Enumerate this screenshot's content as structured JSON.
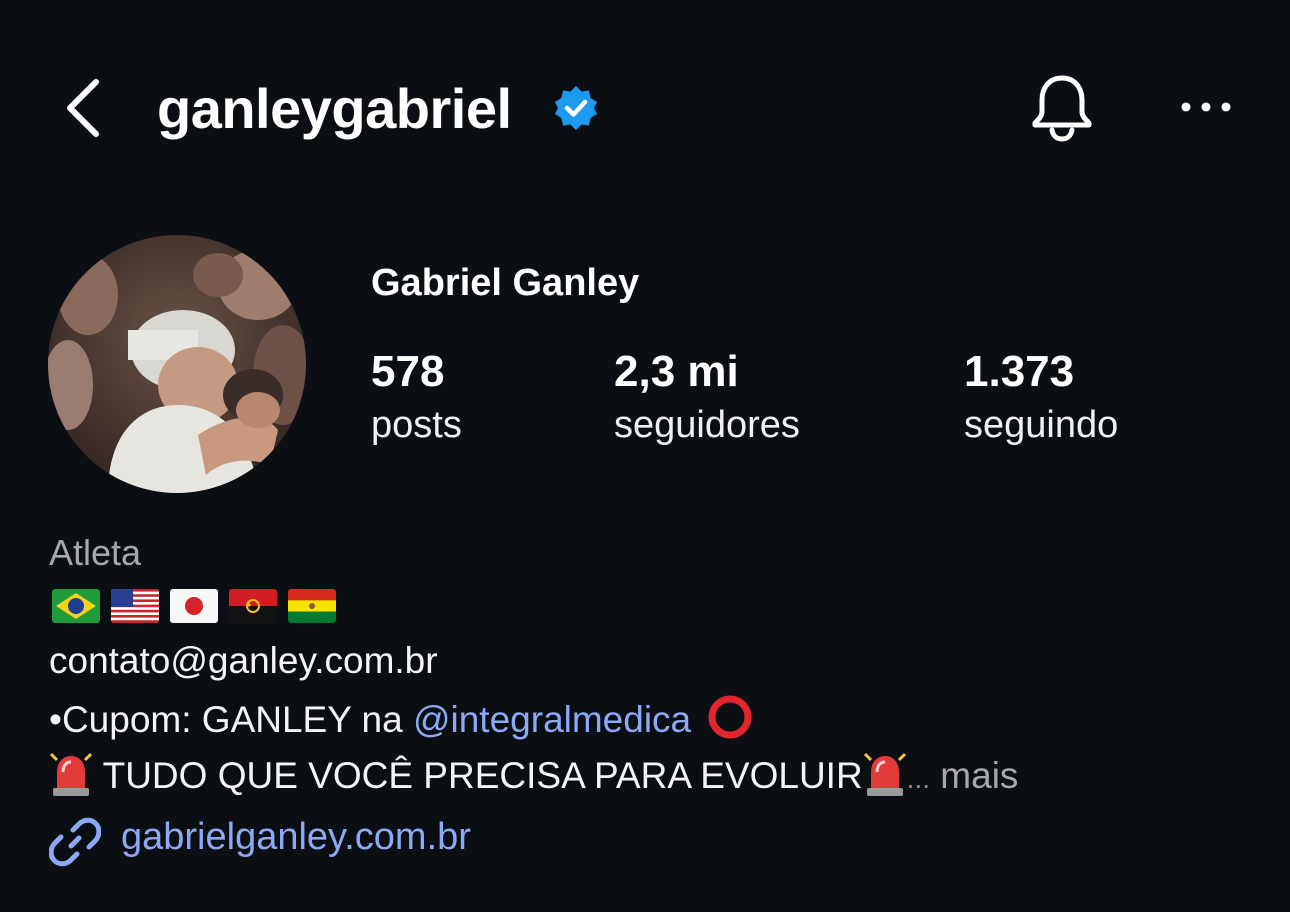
{
  "header": {
    "username": "ganleygabriel",
    "back_icon": "chevron-left-icon",
    "verified_icon": "verified-badge-icon",
    "bell_icon": "bell-icon",
    "more_icon": "more-horizontal-icon"
  },
  "profile": {
    "full_name": "Gabriel Ganley",
    "stats": [
      {
        "value": "578",
        "label": "posts"
      },
      {
        "value": "2,3 mi",
        "label": "seguidores"
      },
      {
        "value": "1.373",
        "label": "seguindo"
      }
    ]
  },
  "bio": {
    "category": "Atleta",
    "flags": [
      "brazil-flag-icon",
      "usa-flag-icon",
      "japan-flag-icon",
      "angola-flag-icon",
      "bolivia-flag-icon"
    ],
    "email": "contato@ganley.com.br",
    "coupon_prefix": "•Cupom: GANLEY na ",
    "coupon_mention": "@integralmedica",
    "tagline": " TUDO QUE VOCÊ PRECISA PARA EVOLUIR",
    "ellipsis": "...",
    "more_label": " mais",
    "link": "gabrielganley.com.br"
  },
  "colors": {
    "background": "#0b0f14",
    "link": "#8ba9f5",
    "verified": "#1d9bf0",
    "muted": "#a8a8a8"
  }
}
